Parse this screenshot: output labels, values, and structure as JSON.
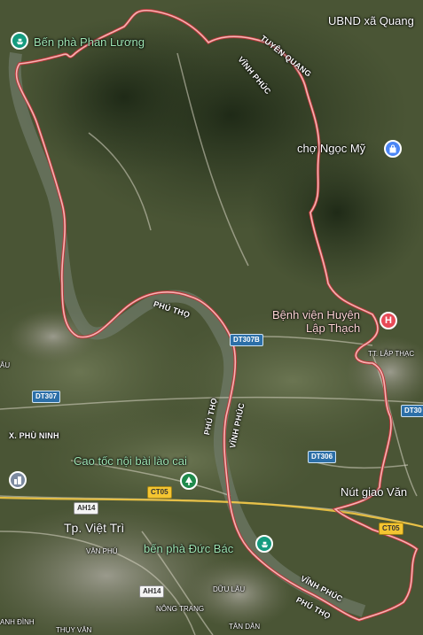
{
  "colors": {
    "border_line": "#f4a3a3",
    "border_casing": "#c9423f",
    "ferry_pin": "#159b7f",
    "hospital_pin": "#e84a57",
    "market_pin": "#4b86f5",
    "park_pin": "#1f8a4c",
    "city_pin": "#7c8aa0"
  },
  "pois": {
    "ben_pha_phan_luong": "Bến phà Phan Lương",
    "ubnd": "UBND xã Quang",
    "cho_ngoc_my": "chợ Ngọc Mỹ",
    "benh_vien_line1": "Bệnh viện Huyện",
    "benh_vien_line2": "Lập Thạch",
    "tt_lap_thach": "TT. LẬP THẠC",
    "cao_toc": "Cao tốc nội bài lào cai",
    "nut_giao": "Nút giao Văn",
    "ben_pha_duc_bac": "bến phà Đức Bác",
    "tp_viet_tri": "Tp. Việt Trì",
    "x_phu_ninh": "X. PHÙ NINH",
    "van_phu": "VÂN PHÚ",
    "du_lau": "DỮU LÂU",
    "nong_trang": "NÔNG TRANG",
    "tan_dan": "TÂN DÂN",
    "thuy_van": "THỤY VÂN",
    "anh_dinh": "ANH ĐÌNH",
    "au": "ÂU"
  },
  "borders": {
    "tuyen_quang": "TUYÊN QUANG",
    "vinh_phuc_top": "VĨNH PHÚC",
    "phu_tho_mid": "PHÚ THỌ",
    "phu_tho_vertical": "PHÚ THỌ",
    "vinh_phuc_vertical": "VĨNH PHÚC",
    "vinh_phuc_bottom": "VĨNH PHÚC",
    "phu_tho_bottom": "PHÚ THỌ"
  },
  "roads": {
    "dt307b": "DT307B",
    "dt307": "DT307",
    "dt306": "DT306",
    "dt30": "DT30",
    "ct05_left": "CT05",
    "ct05_right": "CT05",
    "ah14_top": "AH14",
    "ah14_bottom": "AH14"
  },
  "icons": {
    "ferry": "ferry-icon",
    "hospital": "H",
    "market": "shopping-bag-icon",
    "park": "tree-icon",
    "city": "city-icon"
  }
}
